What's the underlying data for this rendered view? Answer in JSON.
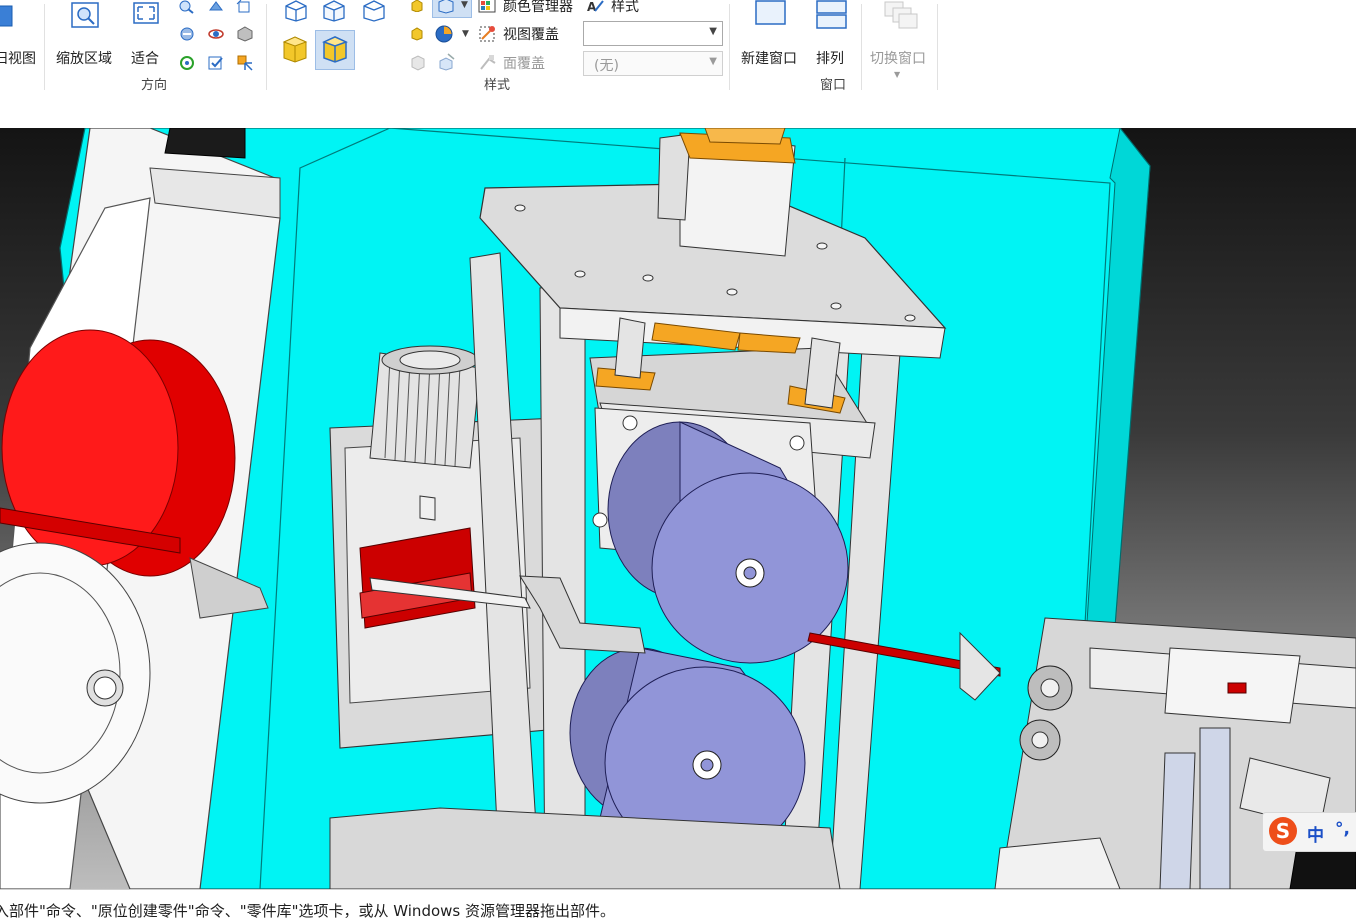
{
  "ribbon": {
    "view_group": {
      "partial_view_label": "旧视图"
    },
    "orientation_group": {
      "label": "方向",
      "zoom_area_label": "缩放区域",
      "fit_label": "适合"
    },
    "style_group": {
      "label": "样式",
      "color_manager_label": "颜色管理器",
      "style_label": "样式",
      "view_overlay_label": "视图覆盖",
      "face_overlay_label": "面覆盖",
      "overlay_dropdown_value": "",
      "face_dropdown_value": "(无)"
    },
    "window_group": {
      "label": "窗口",
      "new_window_label": "新建窗口",
      "arrange_label": "排列",
      "switch_window_label": "切换窗口"
    }
  },
  "ime": {
    "logo": "S",
    "lang": "中",
    "punct": "°,"
  },
  "status_bar": {
    "text": "入部件\"命令、\"原位创建零件\"命令、\"零件库\"选项卡，或从 Windows 资源管理器拖出部件。"
  },
  "colors": {
    "cyan_plate": "#00f5f5",
    "roller": "#8c8fcc",
    "red_part": "#ee0000",
    "orange_part": "#f5a623",
    "frame_grey": "#d9d9d9"
  }
}
